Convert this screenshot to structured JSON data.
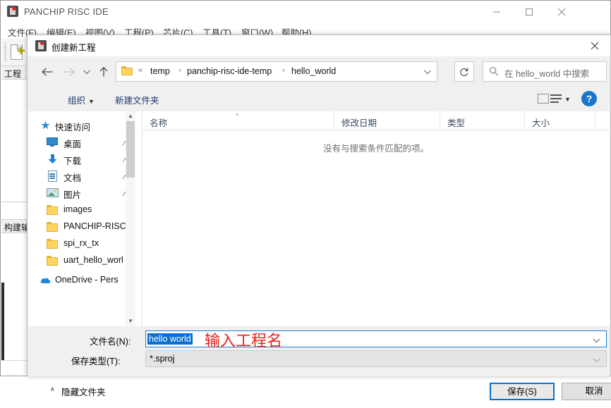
{
  "ide": {
    "title": "PANCHIP RISC IDE",
    "window_buttons": {
      "minimize": "minimize-icon",
      "maximize": "maximize-icon",
      "close": "close-icon"
    },
    "menu": [
      {
        "label": "文件(F)"
      },
      {
        "label": "编辑(E)"
      },
      {
        "label": "视图(V)"
      },
      {
        "label": "工程(P)"
      },
      {
        "label": "芯片(C)"
      },
      {
        "label": "工具(T)"
      },
      {
        "label": "窗口(W)"
      },
      {
        "label": "帮助(H)"
      }
    ],
    "toolbar": {
      "new_project_icon": "new-project-icon"
    },
    "panels": {
      "project": "工程",
      "build_output": "构建输"
    }
  },
  "dialog": {
    "title": "创建新工程",
    "close_label": "close-icon",
    "nav": {
      "back_icon": "arrow-left-icon",
      "forward_icon": "arrow-right-icon",
      "recent_icon": "chevron-down-icon",
      "up_icon": "arrow-up-icon",
      "breadcrumb_prefix": "«",
      "breadcrumb": [
        "temp",
        "panchip-risc-ide-temp",
        "hello_world"
      ],
      "breadcrumb_separator": "›",
      "dropdown_icon": "chevron-down-icon",
      "refresh_icon": "refresh-icon"
    },
    "search": {
      "placeholder": "在 hello_world 中搜索",
      "icon": "search-icon"
    },
    "commandbar": {
      "organize": "组织",
      "organize_caret": "▼",
      "new_folder": "新建文件夹",
      "view_icon": "view-layout-icon",
      "view_caret": "▼",
      "help_icon": "help-icon",
      "help_glyph": "?"
    },
    "navpane": {
      "items": [
        {
          "label": "快速访问",
          "icon": "star-pin-icon",
          "level": 0,
          "pinned": false
        },
        {
          "label": "桌面",
          "icon": "monitor-icon",
          "level": 1,
          "pinned": true
        },
        {
          "label": "下载",
          "icon": "download-arrow-icon",
          "level": 1,
          "pinned": true
        },
        {
          "label": "文档",
          "icon": "document-icon",
          "level": 1,
          "pinned": true
        },
        {
          "label": "图片",
          "icon": "picture-icon",
          "level": 1,
          "pinned": true
        },
        {
          "label": "images",
          "icon": "folder-icon",
          "level": 1,
          "pinned": false
        },
        {
          "label": "PANCHIP-RISC",
          "icon": "folder-icon",
          "level": 1,
          "pinned": false
        },
        {
          "label": "spi_rx_tx",
          "icon": "folder-icon",
          "level": 1,
          "pinned": false
        },
        {
          "label": "uart_hello_worl",
          "icon": "folder-icon",
          "level": 1,
          "pinned": false
        },
        {
          "label": "OneDrive - Pers",
          "icon": "onedrive-cloud-icon",
          "level": 0,
          "pinned": false
        }
      ],
      "scroll_up_icon": "chevron-up-icon",
      "scroll_down_icon": "chevron-down-icon"
    },
    "filelist": {
      "columns": [
        {
          "label": "名称"
        },
        {
          "label": "修改日期"
        },
        {
          "label": "类型"
        },
        {
          "label": "大小"
        }
      ],
      "sort_caret": "^",
      "empty_message": "没有与搜索条件匹配的项。"
    },
    "form": {
      "name_label": "文件名(N):",
      "name_value": "hello world",
      "name_annotation": "输入工程名",
      "type_label": "保存类型(T):",
      "type_value": "*.sproj",
      "dropdown_icon": "chevron-down-icon"
    },
    "footer": {
      "hide_folders": "隐藏文件夹",
      "hide_folders_caret": "∧",
      "save_button": "保存(S)",
      "cancel_button": "取消"
    }
  },
  "colors": {
    "accent_blue": "#0d70c8",
    "selection_blue": "#0a6ed1",
    "annotation_red": "#e8211e",
    "folder_yellow": "#ffd45f",
    "help_blue": "#1976c8"
  }
}
